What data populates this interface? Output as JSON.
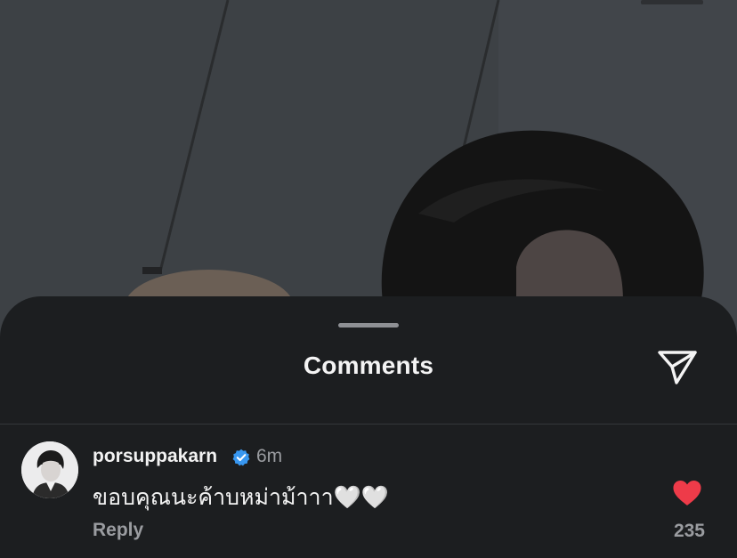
{
  "sheet": {
    "title": "Comments",
    "share_icon": "send-icon"
  },
  "comments": [
    {
      "username": "porsuppakarn",
      "verified": true,
      "time": "6m",
      "text": "ขอบคุณนะค้าบหม่าม้าาา🤍🤍",
      "reply_label": "Reply",
      "likes": "235",
      "liked": true,
      "like_color": "#ee3b49"
    }
  ],
  "colors": {
    "sheet_background": "#1c1e20",
    "verified_badge": "#3897f0"
  }
}
